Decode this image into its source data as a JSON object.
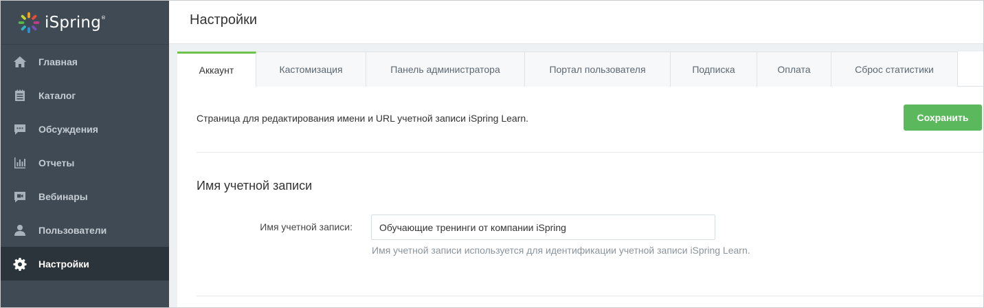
{
  "app": {
    "logo_text": "iSpring",
    "logo_mark": "®"
  },
  "sidebar": {
    "items": [
      {
        "label": "Главная",
        "icon": "home-icon",
        "active": false
      },
      {
        "label": "Каталог",
        "icon": "catalog-icon",
        "active": false
      },
      {
        "label": "Обсуждения",
        "icon": "chat-icon",
        "active": false
      },
      {
        "label": "Отчеты",
        "icon": "bar-chart-icon",
        "active": false
      },
      {
        "label": "Вебинары",
        "icon": "video-icon",
        "active": false
      },
      {
        "label": "Пользователи",
        "icon": "user-icon",
        "active": false
      },
      {
        "label": "Настройки",
        "icon": "gear-icon",
        "active": true
      }
    ]
  },
  "header": {
    "title": "Настройки"
  },
  "tabs": [
    {
      "label": "Аккаунт",
      "active": true
    },
    {
      "label": "Кастомизация",
      "active": false
    },
    {
      "label": "Панель администратора",
      "active": false
    },
    {
      "label": "Портал пользователя",
      "active": false
    },
    {
      "label": "Подписка",
      "active": false
    },
    {
      "label": "Оплата",
      "active": false
    },
    {
      "label": "Сброс статистики",
      "active": false
    }
  ],
  "account": {
    "description": "Страница для редактирования имени и URL учетной записи iSpring Learn.",
    "save_label": "Сохранить",
    "section_title": "Имя учетной записи",
    "name_field": {
      "label": "Имя учетной записи:",
      "value": "Обучающие тренинги от компании iSpring",
      "hint": "Имя учетной записи используется для идентификации учетной записи iSpring Learn."
    }
  },
  "colors": {
    "sidebar_bg": "#3f4a54",
    "sidebar_active_bg": "#2c343b",
    "accent_green": "#5cb85c",
    "tab_active_border": "#6cc24a"
  }
}
